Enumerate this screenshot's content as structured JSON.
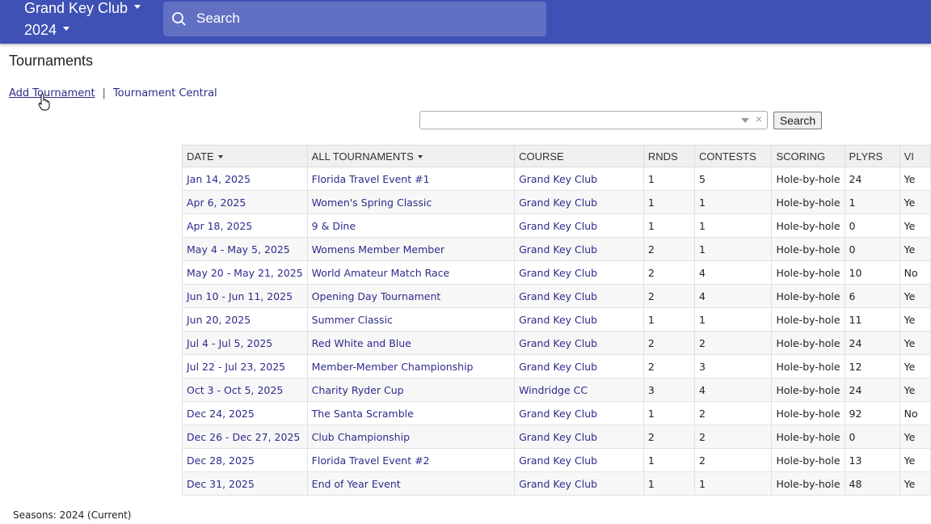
{
  "header": {
    "club": "Grand Key Club",
    "year": "2024",
    "search_placeholder": "Search"
  },
  "page": {
    "title": "Tournaments",
    "add_link": "Add Tournament",
    "separator": "|",
    "central_link": "Tournament Central",
    "search_button": "Search",
    "clear_glyph": "×",
    "seasons": "Seasons: 2024 (Current)"
  },
  "table": {
    "columns": [
      "DATE",
      "ALL TOURNAMENTS",
      "COURSE",
      "RNDS",
      "CONTESTS",
      "SCORING",
      "PLYRS",
      "VI"
    ],
    "rows": [
      [
        "Jan 14, 2025",
        "Florida Travel Event #1",
        "Grand Key Club",
        "1",
        "5",
        "Hole-by-hole",
        "24",
        "Ye"
      ],
      [
        "Apr 6, 2025",
        "Women's Spring Classic",
        "Grand Key Club",
        "1",
        "1",
        "Hole-by-hole",
        "1",
        "Ye"
      ],
      [
        "Apr 18, 2025",
        "9 & Dine",
        "Grand Key Club",
        "1",
        "1",
        "Hole-by-hole",
        "0",
        "Ye"
      ],
      [
        "May 4 - May 5, 2025",
        "Womens Member Member",
        "Grand Key Club",
        "2",
        "1",
        "Hole-by-hole",
        "0",
        "Ye"
      ],
      [
        "May 20 - May 21, 2025",
        "World Amateur Match Race",
        "Grand Key Club",
        "2",
        "4",
        "Hole-by-hole",
        "10",
        "No"
      ],
      [
        "Jun 10 - Jun 11, 2025",
        "Opening Day Tournament",
        "Grand Key Club",
        "2",
        "4",
        "Hole-by-hole",
        "6",
        "Ye"
      ],
      [
        "Jun 20, 2025",
        "Summer Classic",
        "Grand Key Club",
        "1",
        "1",
        "Hole-by-hole",
        "11",
        "Ye"
      ],
      [
        "Jul 4 - Jul 5, 2025",
        "Red White and Blue",
        "Grand Key Club",
        "2",
        "2",
        "Hole-by-hole",
        "24",
        "Ye"
      ],
      [
        "Jul 22 - Jul 23, 2025",
        "Member-Member Championship",
        "Grand Key Club",
        "2",
        "3",
        "Hole-by-hole",
        "12",
        "Ye"
      ],
      [
        "Oct 3 - Oct 5, 2025",
        "Charity Ryder Cup",
        "Windridge CC",
        "3",
        "4",
        "Hole-by-hole",
        "24",
        "Ye"
      ],
      [
        "Dec 24, 2025",
        "The Santa Scramble",
        "Grand Key Club",
        "1",
        "2",
        "Hole-by-hole",
        "92",
        "No"
      ],
      [
        "Dec 26 - Dec 27, 2025",
        "Club Championship",
        "Grand Key Club",
        "2",
        "2",
        "Hole-by-hole",
        "0",
        "Ye"
      ],
      [
        "Dec 28, 2025",
        "Florida Travel Event #2",
        "Grand Key Club",
        "1",
        "2",
        "Hole-by-hole",
        "13",
        "Ye"
      ],
      [
        "Dec 31, 2025",
        "End of Year Event",
        "Grand Key Club",
        "1",
        "1",
        "Hole-by-hole",
        "48",
        "Ye"
      ]
    ]
  }
}
